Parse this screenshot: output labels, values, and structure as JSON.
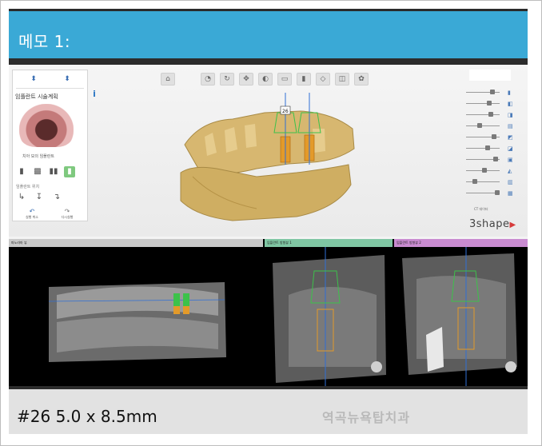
{
  "memo": {
    "title": "메모 1:"
  },
  "left_panel": {
    "title": "임플란트 시술계획",
    "thumbnail_caption": "치아 모의 임플란트",
    "subsection_title": "임플란트 위치",
    "undo_label": "실행 취소",
    "redo_label": "다시실행",
    "tools": [
      "tool-1",
      "tool-2",
      "tool-3",
      "tool-4"
    ]
  },
  "top_toolbar": {
    "icons": [
      "home-icon",
      "tool-icon",
      "tool-icon",
      "tool-icon",
      "tool-icon",
      "tool-icon",
      "implant-icon",
      "tool-icon",
      "tool-icon",
      "tool-icon"
    ]
  },
  "right_panel": {
    "ct_label": "CT 데이터"
  },
  "brand": {
    "name": "3shape",
    "mark": "▶"
  },
  "views": {
    "panorama": {
      "header": "파노라마 뷰"
    },
    "cross1": {
      "header": "임플란트 방향뷰 1"
    },
    "cross2": {
      "header": "임플란트 방향뷰 2"
    }
  },
  "footer": {
    "caption": "#26 5.0 x 8.5mm",
    "watermark": "역곡뉴욕탑치과"
  },
  "colors": {
    "header_blue": "#3aa9d6",
    "model_gold": "#d7b770",
    "implant_orange": "#e39a2a",
    "guide_green": "#3cc24a",
    "axis_blue": "#2f6fd6",
    "brand_red": "#d63a3a"
  }
}
